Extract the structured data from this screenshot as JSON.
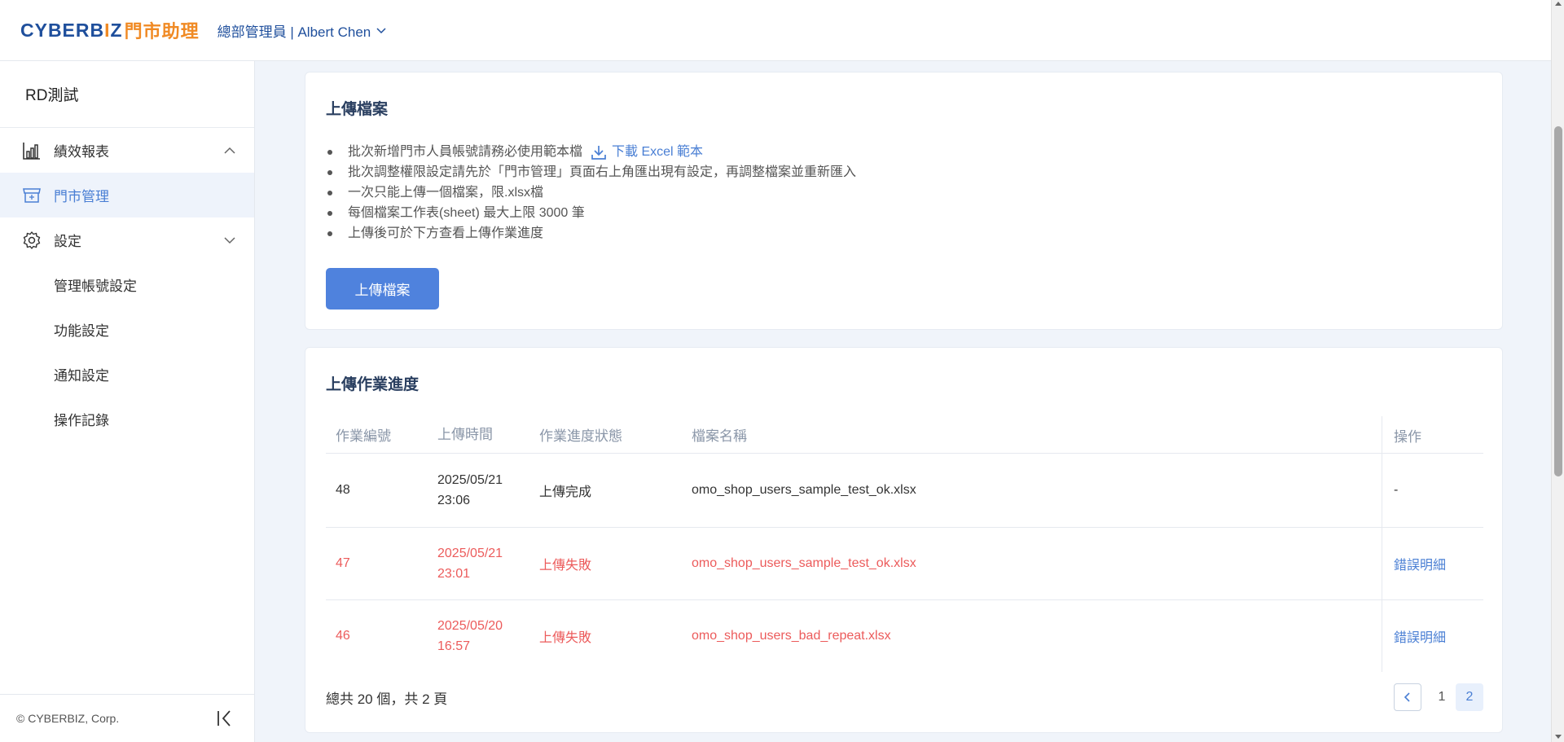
{
  "header": {
    "logo_main": "CYBERB",
    "logo_mid": "I",
    "logo_z": "Z",
    "logo_cn": "門市助理",
    "user_label": "總部管理員 | Albert Chen"
  },
  "sidebar": {
    "store_name": "RD測試",
    "items": [
      {
        "label": "績效報表",
        "icon": "bar-chart-icon"
      },
      {
        "label": "門市管理",
        "icon": "store-icon"
      },
      {
        "label": "設定",
        "icon": "gear-icon"
      }
    ],
    "sub_items": [
      "管理帳號設定",
      "功能設定",
      "通知設定",
      "操作記錄"
    ],
    "copyright": "© CYBERBIZ, Corp."
  },
  "upload_card": {
    "title": "上傳檔案",
    "bullets": [
      "批次新增門市人員帳號請務必使用範本檔",
      "批次調整權限設定請先於「門市管理」頁面右上角匯出現有設定，再調整檔案並重新匯入",
      "一次只能上傳一個檔案，限.xlsx檔",
      "每個檔案工作表(sheet) 最大上限 3000 筆",
      "上傳後可於下方查看上傳作業進度"
    ],
    "download_label": "下載 Excel 範本",
    "button_label": "上傳檔案"
  },
  "progress_card": {
    "title": "上傳作業進度",
    "columns": [
      "作業編號",
      "上傳時間",
      "作業進度狀態",
      "檔案名稱",
      "操作"
    ],
    "rows": [
      {
        "id": "48",
        "date": "2025/05/21",
        "time": "23:06",
        "status": "上傳完成",
        "file": "omo_shop_users_sample_test_ok.xlsx",
        "action": "-"
      },
      {
        "id": "47",
        "date": "2025/05/21",
        "time": "23:01",
        "status": "上傳失敗",
        "file": "omo_shop_users_sample_test_ok.xlsx",
        "action": "錯誤明細"
      },
      {
        "id": "46",
        "date": "2025/05/20",
        "time": "16:57",
        "status": "上傳失敗",
        "file": "omo_shop_users_bad_repeat.xlsx",
        "action": "錯誤明細"
      }
    ],
    "total_label": "總共 20 個，共 2 頁",
    "pages": [
      "1",
      "2"
    ],
    "current_page": "2"
  },
  "colors": {
    "accent": "#4f82dd",
    "brand_blue": "#1f4f9c",
    "brand_orange": "#f08a24",
    "error": "#ec5b5b"
  }
}
